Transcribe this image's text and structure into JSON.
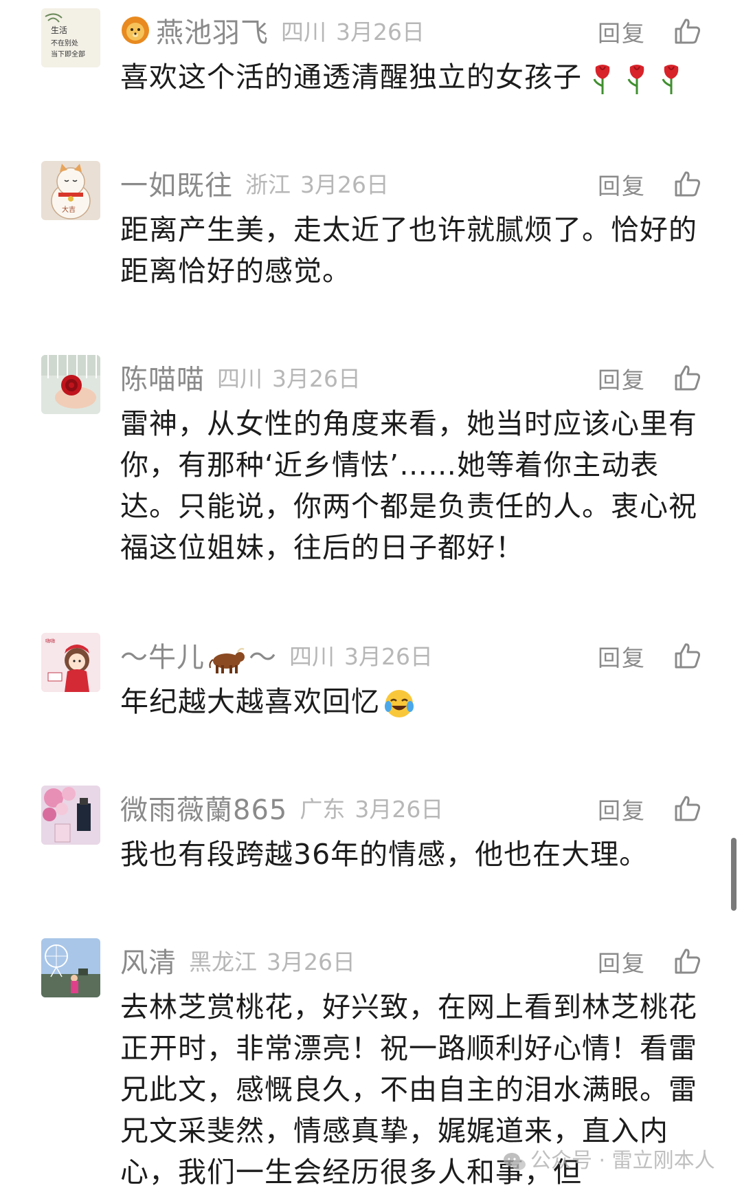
{
  "comments": [
    {
      "name": "燕池羽飞",
      "location": "四川",
      "date": "3月26日",
      "reply_label": "回复",
      "text": "喜欢这个活的通透清醒独立的女孩子",
      "name_prefix_icon": "lion-emoji-icon",
      "text_suffix_icons": [
        "rose-emoji-icon",
        "rose-emoji-icon",
        "rose-emoji-icon"
      ],
      "avatar_text": "生活 不在别处 当下即全部"
    },
    {
      "name": "一如既往",
      "location": "浙江",
      "date": "3月26日",
      "reply_label": "回复",
      "text": "距离产生美，走太近了也许就腻烦了。恰好的距离恰好的感觉。",
      "avatar_icon": "lucky-cat-icon"
    },
    {
      "name": "陈喵喵",
      "location": "四川",
      "date": "3月26日",
      "reply_label": "回复",
      "text": "雷神，从女性的角度来看，她当时应该心里有你，有那种‘近乡情怯’……她等着你主动表达。只能说，你两个都是负责任的人。衷心祝福这位姐妹，往后的日子都好！",
      "avatar_icon": "red-rose-photo-icon"
    },
    {
      "name_left": "～牛儿",
      "name_right": "～",
      "location": "四川",
      "date": "3月26日",
      "reply_label": "回复",
      "text": "年纪越大越喜欢回忆",
      "name_icon": "ox-emoji-icon",
      "text_suffix_icon": "laughing-tears-emoji-icon",
      "avatar_icon": "cartoon-girl-icon"
    },
    {
      "name": "微雨薇蘭865",
      "location": "广东",
      "date": "3月26日",
      "reply_label": "回复",
      "text": "我也有段跨越36年的情感，他也在大理。",
      "avatar_icon": "flowers-perfume-icon"
    },
    {
      "name": "风清",
      "location": "黑龙江",
      "date": "3月26日",
      "reply_label": "回复",
      "text": "去林芝赏桃花，好兴致，在网上看到林芝桃花正开时，非常漂亮！祝一路顺利好心情！看雷兄此文，感慨良久，不由自主的泪水满眼。雷兄文采斐然，情感真挚，娓娓道来，直入内心，我们一生会经历很多人和事，但",
      "avatar_icon": "ferris-wheel-photo-icon"
    }
  ],
  "watermark": {
    "icon": "wechat-icon",
    "text": "公众号 · 雷立刚本人"
  },
  "colors": {
    "name": "#8a8a8a",
    "meta": "#b7b7b7",
    "text": "#1c1c1c",
    "scrollbar": "#7a7a7a"
  }
}
